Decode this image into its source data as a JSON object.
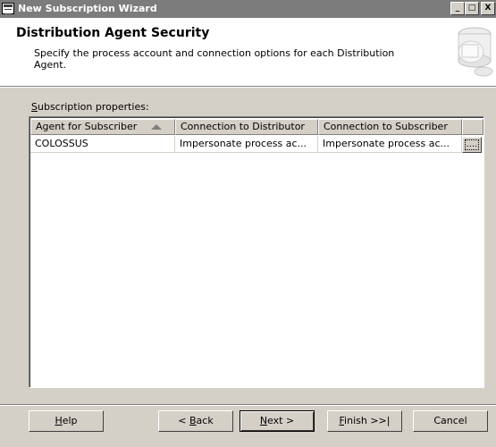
{
  "window": {
    "title": "New Subscription Wizard",
    "minimize_glyph": "_",
    "maximize_glyph": "□",
    "close_glyph": "X"
  },
  "header": {
    "title": "Distribution Agent Security",
    "description": "Specify the process account and connection options for each Distribution Agent."
  },
  "grid": {
    "label_mnemonic": "S",
    "label_rest": "ubscription properties:",
    "columns": [
      "Agent for Subscriber",
      "Connection to Distributor",
      "Connection to Subscriber",
      ""
    ],
    "sort_column": "Agent for Subscriber",
    "sort_direction": "ascending",
    "rows": [
      {
        "agent": "COLOSSUS",
        "distributor": "Impersonate process ac...",
        "subscriber": "Impersonate process ac...",
        "action": "...."
      }
    ]
  },
  "buttons": {
    "help": {
      "mnemonic": "H",
      "rest": "elp"
    },
    "back": {
      "prefix": "< ",
      "mnemonic": "B",
      "rest": "ack"
    },
    "next": {
      "mnemonic": "N",
      "rest": "ext >"
    },
    "finish": {
      "mnemonic": "F",
      "rest": "inish >>|"
    },
    "cancel": {
      "label": "Cancel"
    }
  }
}
